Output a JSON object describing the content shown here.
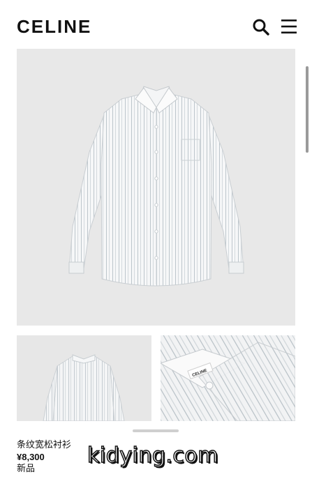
{
  "header": {
    "brand": "CELINE",
    "search_icon": "search-icon",
    "menu_icon": "hamburger-menu-icon"
  },
  "gallery": {
    "main_image": "striped-shirt-front-view",
    "thumbnails": [
      "striped-shirt-back-view",
      "striped-shirt-collar-closeup"
    ]
  },
  "product": {
    "name": "条纹宽松衬衫",
    "price": "¥8,300",
    "badge": "新品"
  },
  "watermark": "kidying.com",
  "colors": {
    "stripe": "#b9c2c8",
    "background": "#e8e8e8"
  }
}
